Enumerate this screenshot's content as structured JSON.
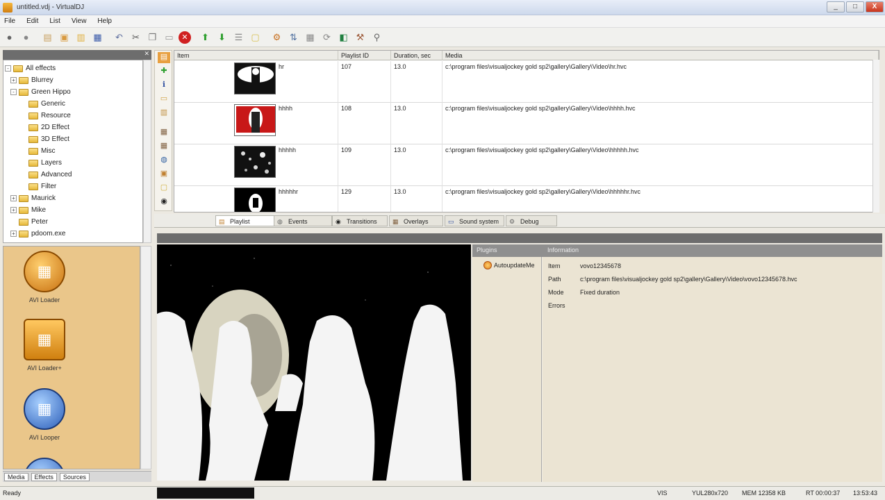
{
  "window": {
    "title": "untitled.vdj - VirtualDJ",
    "minimize": "_",
    "maximize": "□",
    "close": "X"
  },
  "menu": [
    "File",
    "Edit",
    "List",
    "View",
    "Help"
  ],
  "toolbar": {
    "icons": [
      "back-icon",
      "forward-icon",
      "new-icon",
      "open-icon",
      "open-folder-icon",
      "save-icon",
      "undo-icon",
      "cut-icon",
      "copy-icon",
      "paste-icon",
      "delete-icon",
      "move-up-icon",
      "move-down-icon",
      "list-icon",
      "note-icon",
      "import-icon",
      "sort-icon",
      "view-icon",
      "refresh-icon",
      "capture-icon",
      "settings-icon",
      "search-icon"
    ]
  },
  "tree": {
    "items": [
      {
        "label": "All effects",
        "indent": 0,
        "expander": "-"
      },
      {
        "label": "Blurrey",
        "indent": 1,
        "expander": "+"
      },
      {
        "label": "Green Hippo",
        "indent": 1,
        "expander": "-"
      },
      {
        "label": "Generic",
        "indent": 2,
        "expander": ""
      },
      {
        "label": "Resource",
        "indent": 2,
        "expander": ""
      },
      {
        "label": "2D Effect",
        "indent": 2,
        "expander": ""
      },
      {
        "label": "3D Effect",
        "indent": 2,
        "expander": ""
      },
      {
        "label": "Misc",
        "indent": 2,
        "expander": ""
      },
      {
        "label": "Layers",
        "indent": 2,
        "expander": ""
      },
      {
        "label": "Advanced",
        "indent": 2,
        "expander": ""
      },
      {
        "label": "Filter",
        "indent": 2,
        "expander": ""
      },
      {
        "label": "Maurick",
        "indent": 1,
        "expander": "+"
      },
      {
        "label": "Mike",
        "indent": 1,
        "expander": "+"
      },
      {
        "label": "Peter",
        "indent": 1,
        "expander": ""
      },
      {
        "label": "pdoom.exe",
        "indent": 1,
        "expander": "+"
      }
    ]
  },
  "effects": [
    {
      "label": "AVI Loader",
      "color": "#e5962a"
    },
    {
      "label": "AVI Loader+",
      "color": "#e5962a"
    },
    {
      "label": "AVI Looper",
      "color": "#3e78c8"
    }
  ],
  "left_tabs": [
    "Media",
    "Effects",
    "Sources"
  ],
  "playlist": {
    "columns": [
      "Item",
      "Playlist ID",
      "Duration, sec",
      "Media"
    ],
    "rows": [
      {
        "name": "hr",
        "id": "107",
        "duration": "13.0",
        "path": "c:\\program files\\visualjockey gold sp2\\gallery\\Gallery\\Video\\hr.hvc"
      },
      {
        "name": "hhhh",
        "id": "108",
        "duration": "13.0",
        "path": "c:\\program files\\visualjockey gold sp2\\gallery\\Gallery\\Video\\hhhh.hvc"
      },
      {
        "name": "hhhhh",
        "id": "109",
        "duration": "13.0",
        "path": "c:\\program files\\visualjockey gold sp2\\gallery\\Gallery\\Video\\hhhhh.hvc"
      },
      {
        "name": "hhhhhr",
        "id": "129",
        "duration": "13.0",
        "path": "c:\\program files\\visualjockey gold sp2\\gallery\\Gallery\\Video\\hhhhhr.hvc"
      }
    ]
  },
  "mid_tabs": [
    {
      "label": "Playlist",
      "icon": "playlist-icon",
      "active": true
    },
    {
      "label": "Events",
      "icon": "events-icon",
      "active": false
    },
    {
      "label": "Transitions",
      "icon": "transitions-icon",
      "active": false
    },
    {
      "label": "Overlays",
      "icon": "overlays-icon",
      "active": false
    },
    {
      "label": "Sound system",
      "icon": "sound-icon",
      "active": false
    },
    {
      "label": "Debug",
      "icon": "debug-icon",
      "active": false
    }
  ],
  "info": {
    "header_left": "Plugins",
    "header_right": "Information",
    "plugin": "AutoupdateMe",
    "fields": [
      {
        "key": "Item",
        "value": "vovo12345678"
      },
      {
        "key": "Path",
        "value": "c:\\program files\\visualjockey gold sp2\\gallery\\Gallery\\Video\\vovo12345678.hvc"
      },
      {
        "key": "Mode",
        "value": "Fixed duration"
      },
      {
        "key": "Errors",
        "value": ""
      }
    ]
  },
  "status": {
    "ready": "Ready",
    "mode": "VIS",
    "resolution": "YUL280x720",
    "memory": "MEM 12358 KB",
    "time": "RT 00:00:37",
    "clock": "13:53:43"
  }
}
